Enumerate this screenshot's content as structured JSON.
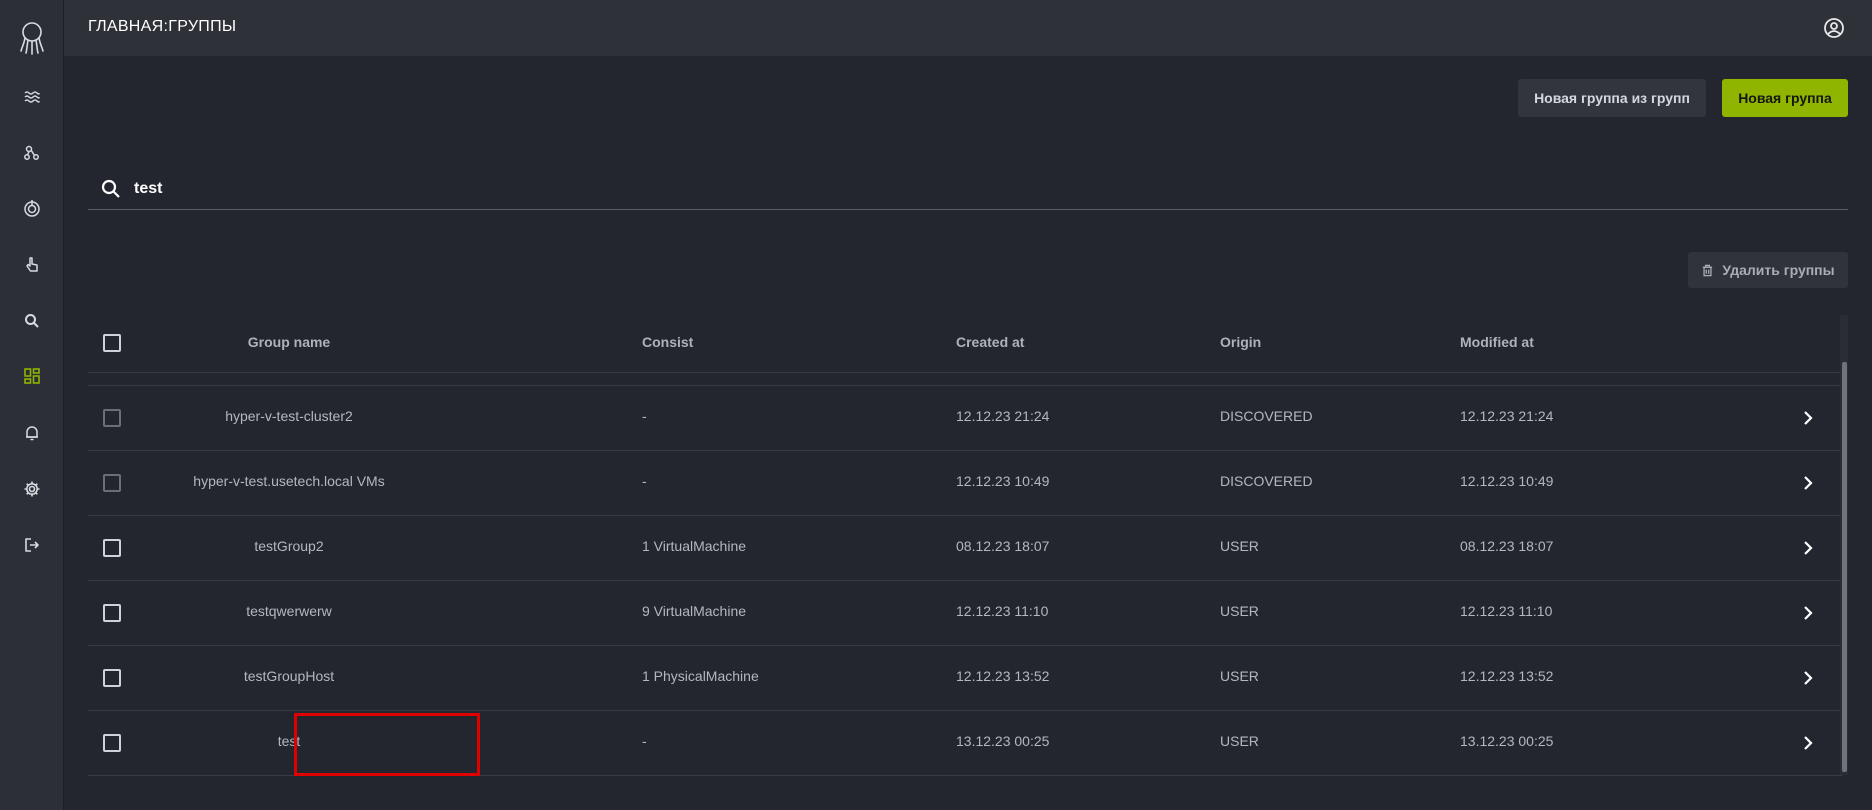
{
  "header": {
    "title": "ГЛАВНАЯ:ГРУППЫ"
  },
  "actions": {
    "new_group_from_groups": "Новая группа из групп",
    "new_group": "Новая группа",
    "delete_groups": "Удалить группы"
  },
  "search": {
    "value": "test"
  },
  "table": {
    "columns": {
      "group_name": "Group name",
      "consist": "Consist",
      "created_at": "Created at",
      "origin": "Origin",
      "modified_at": "Modified at"
    },
    "rows": [
      {
        "name": "hyper-v-test-cluster2",
        "consist": "-",
        "created": "12.12.23 21:24",
        "origin": "DISCOVERED",
        "modified": "12.12.23 21:24"
      },
      {
        "name": "hyper-v-test.usetech.local VMs",
        "consist": "-",
        "created": "12.12.23 10:49",
        "origin": "DISCOVERED",
        "modified": "12.12.23 10:49"
      },
      {
        "name": "testGroup2",
        "consist": "1 VirtualMachine",
        "created": "08.12.23 18:07",
        "origin": "USER",
        "modified": "08.12.23 18:07"
      },
      {
        "name": "testqwerwerw",
        "consist": "9 VirtualMachine",
        "created": "12.12.23 11:10",
        "origin": "USER",
        "modified": "12.12.23 11:10"
      },
      {
        "name": "testGroupHost",
        "consist": "1 PhysicalMachine",
        "created": "12.12.23 13:52",
        "origin": "USER",
        "modified": "12.12.23 13:52"
      },
      {
        "name": "test",
        "consist": "-",
        "created": "13.12.23 00:25",
        "origin": "USER",
        "modified": "13.12.23 00:25"
      }
    ]
  },
  "colors": {
    "accent": "#8fb500",
    "background": "#23262e",
    "highlight": "#e00000"
  },
  "icons": {
    "logo": "octopus-logo-icon",
    "nav": [
      "waves-icon",
      "nodes-icon",
      "target-icon",
      "touch-icon",
      "search-icon",
      "dashboard-icon",
      "bell-icon",
      "gear-icon",
      "logout-icon"
    ],
    "account": "account-circle-icon",
    "row_action": "chevron-right-icon",
    "delete": "trash-icon"
  }
}
